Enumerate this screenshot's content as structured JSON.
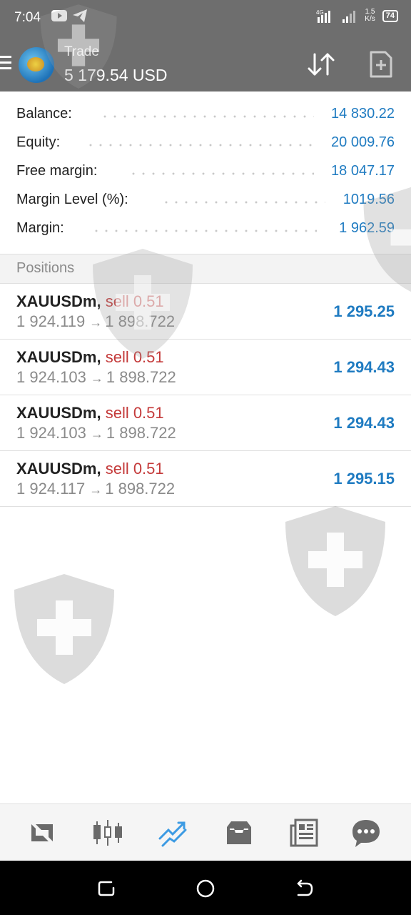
{
  "status_bar": {
    "time": "7:04",
    "network_speed_value": "1.5",
    "network_speed_unit": "K/s",
    "battery_level": "74"
  },
  "app_bar": {
    "title": "Trade",
    "balance": "5 179.54 USD"
  },
  "summary": [
    {
      "label": "Balance:",
      "value": "14 830.22"
    },
    {
      "label": "Equity:",
      "value": "20 009.76"
    },
    {
      "label": "Free margin:",
      "value": "18 047.17"
    },
    {
      "label": "Margin Level (%):",
      "value": "1019.56"
    },
    {
      "label": "Margin:",
      "value": "1 962.59"
    }
  ],
  "positions_header": "Positions",
  "positions": [
    {
      "symbol": "XAUUSDm,",
      "type": "sell 0.51",
      "open_price": "1 924.119",
      "arrow": "→",
      "current_price": "1 898.722",
      "profit": "1 295.25"
    },
    {
      "symbol": "XAUUSDm,",
      "type": "sell 0.51",
      "open_price": "1 924.103",
      "arrow": "→",
      "current_price": "1 898.722",
      "profit": "1 294.43"
    },
    {
      "symbol": "XAUUSDm,",
      "type": "sell 0.51",
      "open_price": "1 924.103",
      "arrow": "→",
      "current_price": "1 898.722",
      "profit": "1 294.43"
    },
    {
      "symbol": "XAUUSDm,",
      "type": "sell 0.51",
      "open_price": "1 924.117",
      "arrow": "→",
      "current_price": "1 898.722",
      "profit": "1 295.15"
    }
  ],
  "bottom_nav": [
    {
      "icon": "quotes-icon",
      "active": false
    },
    {
      "icon": "chart-icon",
      "active": false
    },
    {
      "icon": "trade-icon",
      "active": true
    },
    {
      "icon": "history-icon",
      "active": false
    },
    {
      "icon": "news-icon",
      "active": false
    },
    {
      "icon": "messages-icon",
      "active": false
    }
  ],
  "colors": {
    "accent_blue": "#1f7bc1",
    "sell_red": "#c43a3a",
    "header_gray": "#6e6e6e",
    "muted_text": "#8a8a8a"
  }
}
